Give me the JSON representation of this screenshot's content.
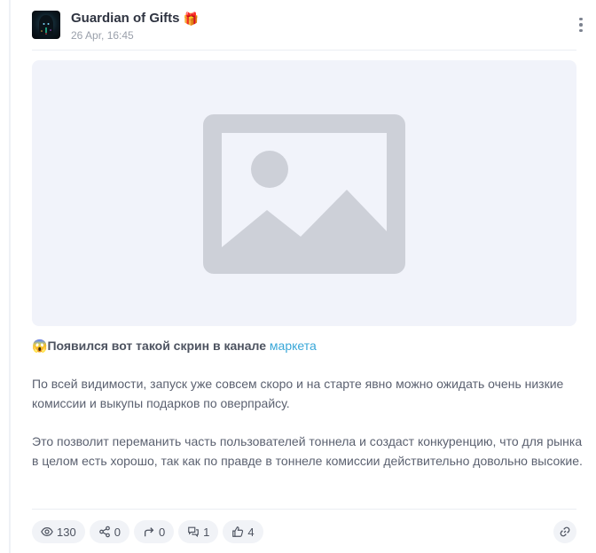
{
  "channel": {
    "title": "Guardian of Gifts",
    "title_emoji": "🎁",
    "timestamp": "26 Apr, 16:45",
    "avatar_icon": "hooded-figure-avatar"
  },
  "post": {
    "image_placeholder_icon": "image-placeholder-icon",
    "lead_emoji": "😱",
    "lead_text": "Появился вот такой скрин в канале",
    "lead_link": "маркета",
    "paragraph_1": "По всей видимости, запуск уже совсем скоро и на старте явно можно ожидать очень низкие комиссии и выкупы подарков по оверпрайсу.",
    "paragraph_2": "Это позволит переманить часть пользователей тоннела и создаст конкуренцию, что для рынка в целом есть хорошо, так как по правде в тоннеле комиссии действительно довольно высокие."
  },
  "stats": {
    "views": "130",
    "shares": "0",
    "forwards": "0",
    "comments": "1",
    "likes": "4"
  },
  "colors": {
    "link": "#39a7d8",
    "chip_bg": "#f1f3f7",
    "placeholder_bg": "#f1f3fa",
    "placeholder_icon": "#cdd0d8"
  }
}
